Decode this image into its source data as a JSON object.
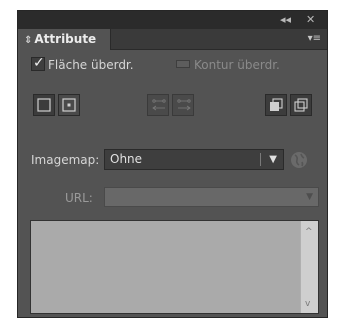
{
  "titlebar": {
    "collapse_glyph": "◂◂",
    "close_glyph": "✕"
  },
  "tab": {
    "arrows_glyph": "⇕",
    "label": "Attribute"
  },
  "panel_menu_glyph": "▾≡",
  "fill": {
    "label": "Fläche überdr.",
    "checked": true,
    "check_glyph": "✓"
  },
  "stroke": {
    "label": "Kontur überdr.",
    "enabled": false
  },
  "imagemap": {
    "label": "Imagemap:",
    "value": "Ohne",
    "caret": "▼"
  },
  "url": {
    "label": "URL:",
    "value": "",
    "caret": "▼",
    "enabled": false
  },
  "scrollbar": {
    "up_glyph": "^",
    "down_glyph": "v"
  },
  "icons": [
    "stop-square-icon",
    "stop-target-icon",
    "link-left-icon",
    "link-right-icon",
    "shape-front-icon",
    "shape-overlap-icon",
    "globe-icon"
  ],
  "colors": {
    "panel": "#535353",
    "titlebar": "#2b2b2b",
    "list": "#aaaaaa"
  }
}
